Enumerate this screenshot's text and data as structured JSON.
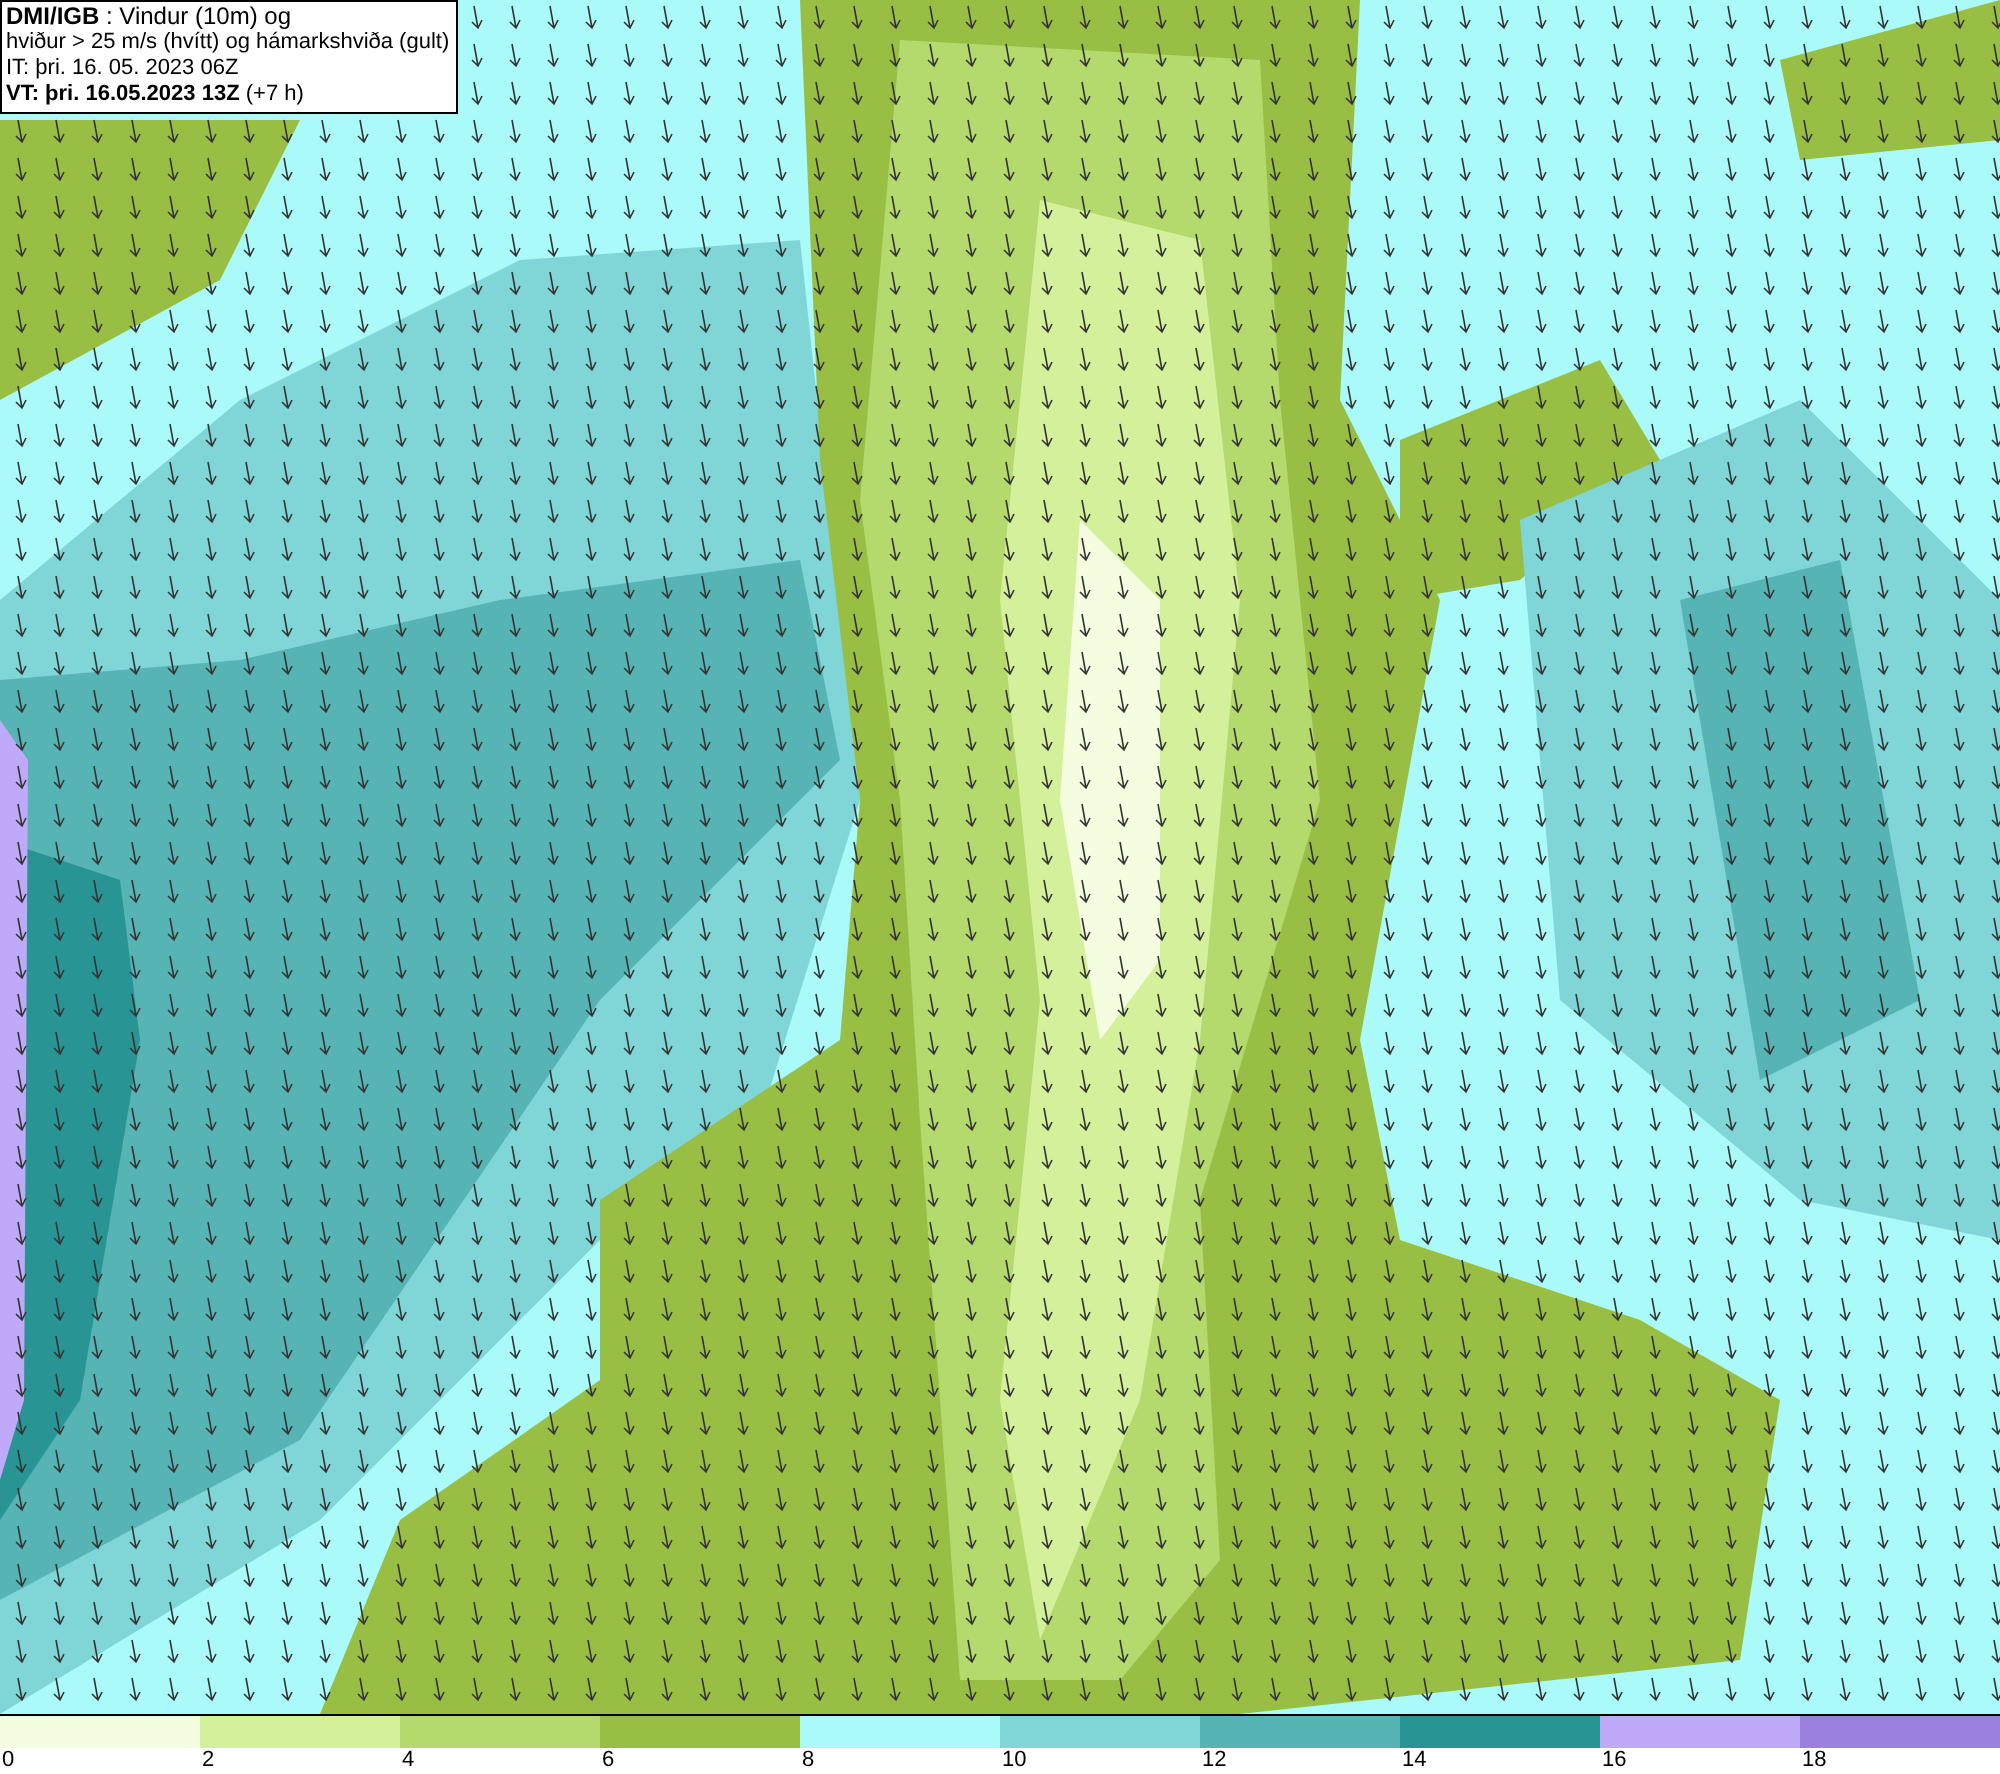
{
  "info_box": {
    "lines": [
      "**DMI/IGB** : Vindur (10m) og",
      "hviður > 25 m/s (hvítt) og hámarkshviða (gult)",
      "IT: þri. 16. 05. 2023 06Z",
      "**VT: þri. 16.05.2023 13Z** (+7 h)"
    ]
  },
  "legend": [
    {
      "label": "0",
      "color": "#f4fde0"
    },
    {
      "label": "2",
      "color": "#d4f09a"
    },
    {
      "label": "4",
      "color": "#b4d96c"
    },
    {
      "label": "6",
      "color": "#98bf44"
    },
    {
      "label": "8",
      "color": "#aafafa"
    },
    {
      "label": "10",
      "color": "#80d6d6"
    },
    {
      "label": "12",
      "color": "#56b4b4"
    },
    {
      "label": "14",
      "color": "#289494"
    },
    {
      "label": "16",
      "color": "#beaaf8"
    },
    {
      "label": "18",
      "color": "#9c80e0"
    }
  ]
}
